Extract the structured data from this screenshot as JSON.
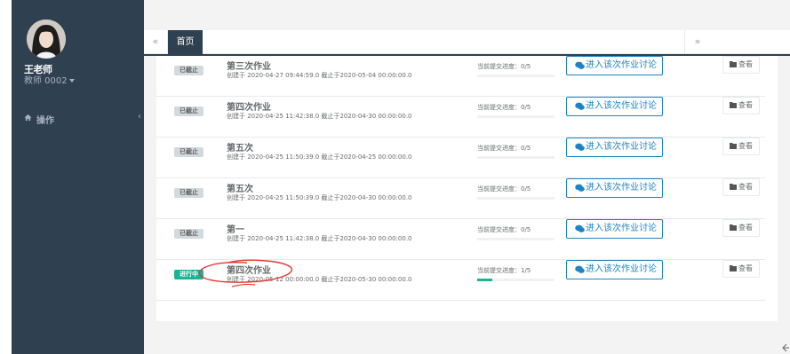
{
  "user": {
    "name": "王老师",
    "role": "教师 0002"
  },
  "nav": {
    "items": [
      {
        "label": "操作"
      }
    ]
  },
  "tabs": {
    "home": "首页",
    "left_glyph": "«",
    "right_glyph": "»"
  },
  "homework": {
    "rows": [
      {
        "status": "已截止",
        "status_type": "closed",
        "title": "第三次作业",
        "meta": "创建于 2020-04-27 09:44:59.0 截止于2020-05-04 00:00:00.0",
        "progress_label": "当前提交进度：0/5",
        "progress": 0.0,
        "discuss_label": "进入该次作业讨论",
        "view_label": "查看"
      },
      {
        "status": "已截止",
        "status_type": "closed",
        "title": "第四次作业",
        "meta": "创建于 2020-04-25 11:42:38.0 截止于2020-04-30 00:00:00.0",
        "progress_label": "当前提交进度：0/5",
        "progress": 0.0,
        "discuss_label": "进入该次作业讨论",
        "view_label": "查看"
      },
      {
        "status": "已截止",
        "status_type": "closed",
        "title": "第五次",
        "meta": "创建于 2020-04-25 11:50:39.0 截止于2020-04-25 00:00:00.0",
        "progress_label": "当前提交进度：0/5",
        "progress": 0.0,
        "discuss_label": "进入该次作业讨论",
        "view_label": "查看"
      },
      {
        "status": "已截止",
        "status_type": "closed",
        "title": "第五次",
        "meta": "创建于 2020-04-25 11:50:39.0 截止于2020-04-30 00:00:00.0",
        "progress_label": "当前提交进度：0/5",
        "progress": 0.0,
        "discuss_label": "进入该次作业讨论",
        "view_label": "查看"
      },
      {
        "status": "已截止",
        "status_type": "closed",
        "title": "第一",
        "meta": "创建于 2020-04-25 11:42:38.0 截止于2020-04-30 00:00:00.0",
        "progress_label": "当前提交进度：0/5",
        "progress": 0.0,
        "discuss_label": "进入该次作业讨论",
        "view_label": "查看"
      },
      {
        "status": "进行中",
        "status_type": "active",
        "title": "第四次作业",
        "meta": "创建于 2020-05-12 00:00:00.0 截止于2020-05-30 00:00:00.0",
        "progress_label": "当前提交进度：1/5",
        "progress": 0.2,
        "discuss_label": "进入该次作业讨论",
        "view_label": "查看"
      }
    ]
  },
  "colors": {
    "sidebar": "#2f4050",
    "accent": "#1ab394",
    "link": "#1c84c6",
    "annotation": "#e53935"
  }
}
